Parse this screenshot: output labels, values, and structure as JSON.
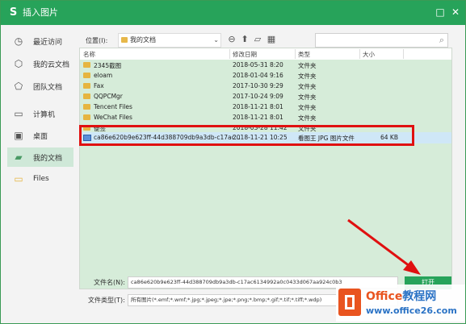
{
  "window": {
    "title": "插入图片",
    "logo": "S",
    "minimize": "–",
    "maximize": "□",
    "close": "✕"
  },
  "sidebar": {
    "items": [
      {
        "label": "最近访问",
        "icon": "clock-icon"
      },
      {
        "label": "我的云文档",
        "icon": "cube-icon"
      },
      {
        "label": "团队文档",
        "icon": "team-icon"
      },
      {
        "label": "计算机",
        "icon": "monitor-icon"
      },
      {
        "label": "桌面",
        "icon": "desktop-icon"
      },
      {
        "label": "我的文档",
        "icon": "folder-icon"
      },
      {
        "label": "Files",
        "icon": "folder-icon"
      }
    ]
  },
  "location": {
    "label": "位置(I):",
    "value": "我的文档"
  },
  "columns": {
    "name": "名称",
    "modified": "修改日期",
    "type": "类型",
    "size": "大小"
  },
  "files": [
    {
      "name": "2345截图",
      "modified": "2018-05-31 8:20",
      "type": "文件夹",
      "size": ""
    },
    {
      "name": "eloam",
      "modified": "2018-01-04 9:16",
      "type": "文件夹",
      "size": ""
    },
    {
      "name": "Fax",
      "modified": "2017-10-30 9:29",
      "type": "文件夹",
      "size": ""
    },
    {
      "name": "QQPCMgr",
      "modified": "2017-10-24 9:09",
      "type": "文件夹",
      "size": ""
    },
    {
      "name": "Tencent Files",
      "modified": "2018-11-21 8:01",
      "type": "文件夹",
      "size": ""
    },
    {
      "name": "WeChat Files",
      "modified": "2018-11-21 8:01",
      "type": "文件夹",
      "size": ""
    },
    {
      "name": "便签",
      "modified": "2018-03-28 11:42",
      "type": "文件夹",
      "size": ""
    },
    {
      "name": "ca86e620b9e623ff-44d388709db9a3db-c17ac...",
      "modified": "2018-11-21 10:25",
      "type": "看图王 JPG 图片文件",
      "size": "64 KB"
    }
  ],
  "filename": {
    "label": "文件名(N):",
    "value": "ca86e620b9e623ff-44d388709db9a3db-c17ac6134992a0c0433d067aa924c0b3"
  },
  "filetype": {
    "label": "文件类型(T):",
    "value": "所有图片(*.emf;*.wmf;*.jpg;*.jpeg;*.jpe;*.png;*.bmp;*.gif;*.tif;*.tiff;*.wdp)"
  },
  "open_button": "打开",
  "watermark": {
    "line1a": "Office",
    "line1b": "教程网",
    "line2": "www.office26.com"
  },
  "colors": {
    "accent": "#27a35a",
    "highlight": "#e01010"
  }
}
